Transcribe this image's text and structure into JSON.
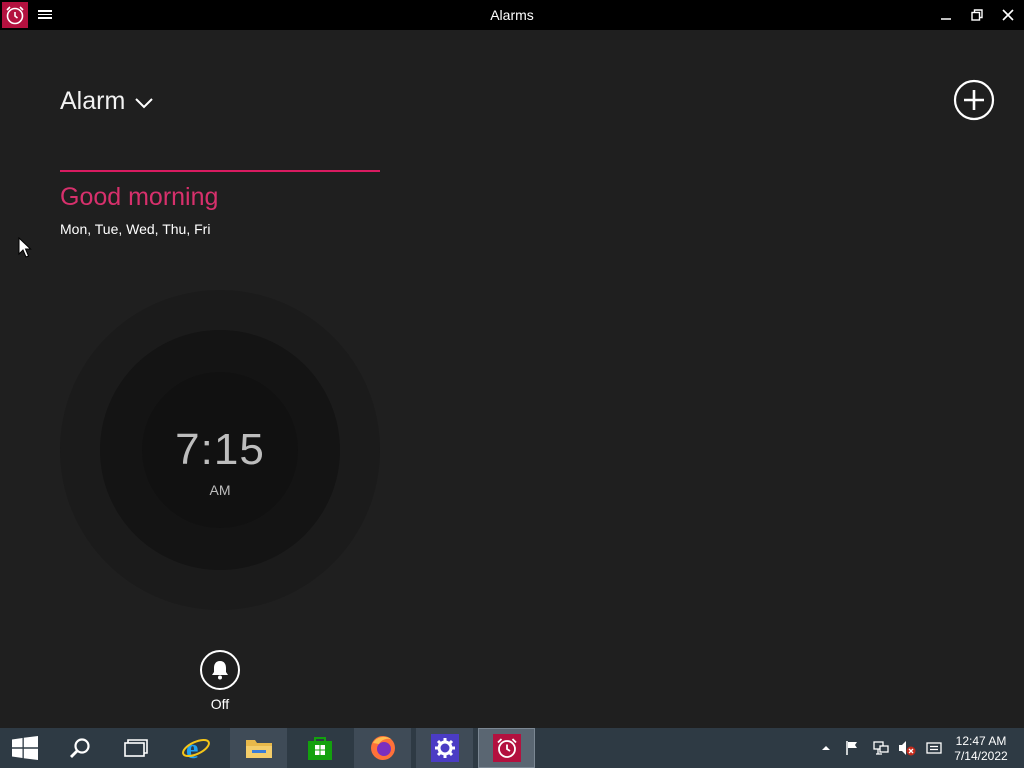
{
  "window": {
    "title": "Alarms"
  },
  "header": {
    "view_label": "Alarm"
  },
  "alarm": {
    "name": "Good morning",
    "days": "Mon, Tue, Wed, Thu, Fri",
    "time": "7:15",
    "ampm": "AM",
    "toggle_label": "Off",
    "accent_color": "#d81b60"
  },
  "taskbar": {
    "apps": [
      {
        "name": "start",
        "icon": "windows-logo-icon"
      },
      {
        "name": "search",
        "icon": "search-icon"
      },
      {
        "name": "task-view",
        "icon": "task-view-icon"
      },
      {
        "name": "internet-explorer",
        "icon": "internet-explorer-icon"
      },
      {
        "name": "file-explorer",
        "icon": "folder-icon"
      },
      {
        "name": "store",
        "icon": "store-icon"
      },
      {
        "name": "firefox",
        "icon": "firefox-icon"
      },
      {
        "name": "settings",
        "icon": "gear-icon"
      },
      {
        "name": "alarms",
        "icon": "alarm-clock-icon"
      }
    ],
    "tray": {
      "time": "12:47 AM",
      "date": "7/14/2022",
      "icons": [
        "chevron-up-icon",
        "flag-icon",
        "network-icon",
        "volume-muted-icon",
        "notification-icon"
      ]
    }
  },
  "colors": {
    "background": "#1f1f1f",
    "titlebar": "#000000",
    "taskbar": "#2e3a44",
    "app_accent": "#b3113f"
  }
}
